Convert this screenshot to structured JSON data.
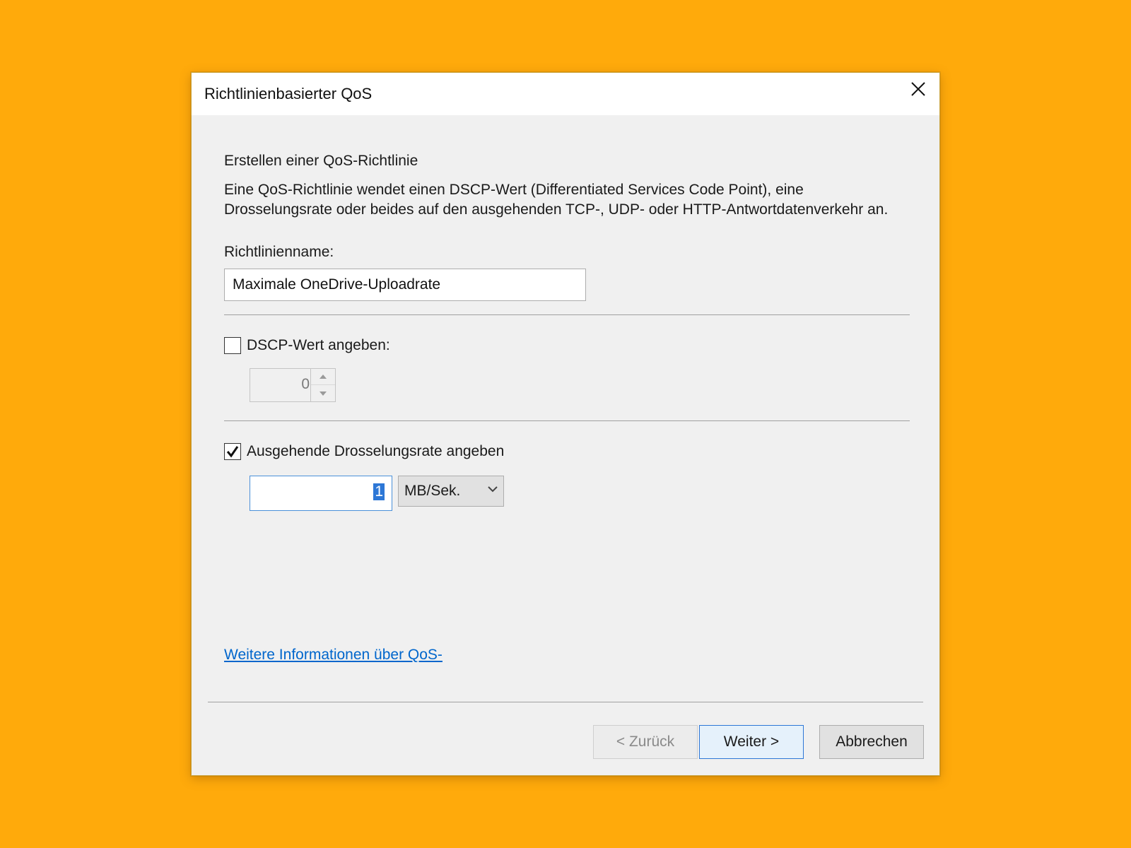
{
  "window": {
    "title": "Richtlinienbasierter QoS",
    "close_icon": "close-icon"
  },
  "content": {
    "heading": "Erstellen einer QoS-Richtlinie",
    "description": "Eine QoS-Richtlinie wendet einen DSCP-Wert (Differentiated Services Code Point), eine Drosselungsrate oder beides auf den ausgehenden TCP-, UDP- oder HTTP-Antwortdatenverkehr an.",
    "policy_name_label": "Richtlinienname:",
    "policy_name_value": "Maximale OneDrive-Uploadrate"
  },
  "dscp": {
    "label": "DSCP-Wert angeben:",
    "checked": false,
    "value": "0"
  },
  "throttle": {
    "label": "Ausgehende Drosselungsrate angeben",
    "checked": true,
    "value": "1",
    "unit": "MB/Sek."
  },
  "link": {
    "text": "Weitere Informationen über QoS-"
  },
  "buttons": {
    "back": "< Zurück",
    "next": "Weiter >",
    "cancel": "Abbrechen"
  },
  "colors": {
    "background": "#FFAA0B",
    "accent": "#2d77d6",
    "link": "#0066cc"
  }
}
